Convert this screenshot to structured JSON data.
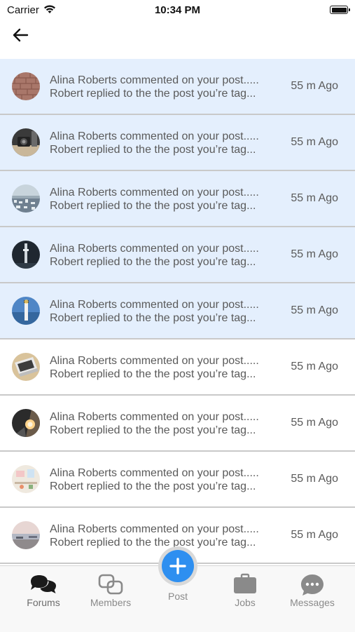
{
  "status_bar": {
    "carrier": "Carrier",
    "time": "10:34 PM"
  },
  "nav": {
    "back_icon": "arrow-left-icon"
  },
  "notifications": [
    {
      "line1": "Alina Roberts commented on your post.....",
      "line2": "Robert  replied to the the post you’re tag...",
      "time": "55 m Ago",
      "unread": true,
      "avatar": "brick-wall"
    },
    {
      "line1": "Alina Roberts commented on your post.....",
      "line2": "Robert  replied to the the post you’re tag...",
      "time": "55 m Ago",
      "unread": true,
      "avatar": "camera-desk"
    },
    {
      "line1": "Alina Roberts commented on your post.....",
      "line2": "Robert  replied to the the post you’re tag...",
      "time": "55 m Ago",
      "unread": true,
      "avatar": "city-aerial"
    },
    {
      "line1": "Alina Roberts commented on your post.....",
      "line2": "Robert  replied to the the post you’re tag...",
      "time": "55 m Ago",
      "unread": true,
      "avatar": "tower-night"
    },
    {
      "line1": "Alina Roberts commented on your post.....",
      "line2": "Robert  replied to the the post you’re tag...",
      "time": "55 m Ago",
      "unread": true,
      "avatar": "lighthouse-sky"
    },
    {
      "line1": "Alina Roberts commented on your post.....",
      "line2": "Robert  replied to the the post you’re tag...",
      "time": "55 m Ago",
      "unread": false,
      "avatar": "laptop"
    },
    {
      "line1": "Alina Roberts commented on your post.....",
      "line2": "Robert  replied to the the post you’re tag...",
      "time": "55 m Ago",
      "unread": false,
      "avatar": "tunnel-light"
    },
    {
      "line1": "Alina Roberts commented on your post.....",
      "line2": "Robert  replied to the the post you’re tag...",
      "time": "55 m Ago",
      "unread": false,
      "avatar": "workspace"
    },
    {
      "line1": "Alina Roberts commented on your post.....",
      "line2": "Robert  replied to the the post you’re tag...",
      "time": "55 m Ago",
      "unread": false,
      "avatar": "beach-dusk"
    }
  ],
  "tabbar": {
    "forums": {
      "label": "Forums",
      "icon": "chat-bubbles-icon"
    },
    "members": {
      "label": "Members",
      "icon": "linked-squares-icon"
    },
    "post": {
      "label": "Post",
      "icon": "plus-icon"
    },
    "jobs": {
      "label": "Jobs",
      "icon": "briefcase-icon"
    },
    "messages": {
      "label": "Messages",
      "icon": "message-dots-icon"
    }
  },
  "colors": {
    "unread_row": "#e4effd",
    "accent": "#2e8ff0",
    "divider": "#c9c9c9"
  }
}
